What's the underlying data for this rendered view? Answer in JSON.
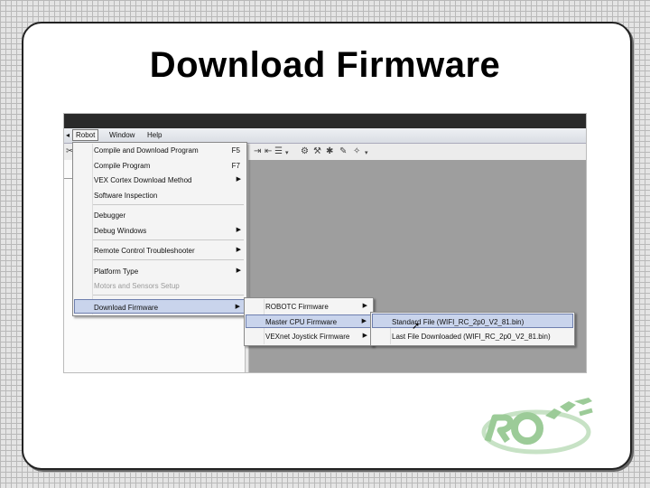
{
  "slide": {
    "title": "Download Firmware"
  },
  "menubar": {
    "robot": "Robot",
    "window": "Window",
    "help": "Help"
  },
  "robot_menu": {
    "items": [
      {
        "label": "Compile and Download Program",
        "shortcut": "F5"
      },
      {
        "label": "Compile Program",
        "shortcut": "F7"
      },
      {
        "label": "VEX Cortex Download Method"
      },
      {
        "label": "Software Inspection"
      },
      {
        "label": "Debugger"
      },
      {
        "label": "Debug Windows"
      },
      {
        "label": "Remote Control Troubleshooter"
      },
      {
        "label": "Platform Type"
      },
      {
        "label": "Motors and Sensors Setup"
      },
      {
        "label": "Download Firmware"
      }
    ]
  },
  "firmware_menu": {
    "items": [
      {
        "label": "ROBOTC Firmware"
      },
      {
        "label": "Master CPU Firmware"
      },
      {
        "label": "VEXnet Joystick Firmware"
      }
    ]
  },
  "master_menu": {
    "items": [
      {
        "label": "Standard File (WIFI_RC_2p0_V2_81.bin)"
      },
      {
        "label": "Last File Downloaded (WIFI_RC_2p0_V2_81.bin)"
      }
    ]
  },
  "logo": {
    "text": "ROBOT",
    "color": "#a9d3a6"
  }
}
